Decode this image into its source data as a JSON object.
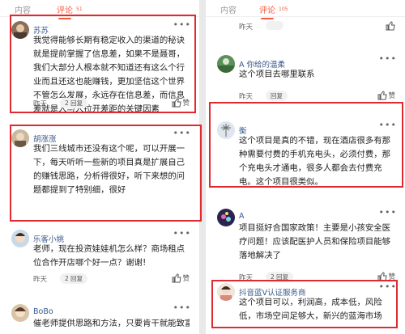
{
  "left": {
    "tabs": [
      {
        "label": "内容"
      },
      {
        "label": "评论",
        "count": "51"
      }
    ],
    "comments": [
      {
        "name": "苏苏",
        "text": "我觉得能够长期有稳定收入的渠道的秘诀就是提前掌握了信息差，如果不是聂哥，我们大部分人根本就不知道还有这么个行业而且还这也能赚钱，更加坚信这个世界不管怎么发展，永远存在信息差，而信息差就是人与人拉开差距的关键因素",
        "time": "昨天",
        "replies": "2 回复",
        "like": "赞"
      },
      {
        "name": "胡涨涨",
        "text": "我们三线城市还没有这个呢，可以开展一下，每天听听一些新的项目真是扩展自己的赚钱思路，分析得很好，听下来想的问题都提到了特别细，很好",
        "time": "",
        "replies": "",
        "like": ""
      },
      {
        "name": "乐客小姚",
        "text": "老师，现在投资娃娃机怎么样？商场租点位合作开店哪个好一点？谢谢!",
        "time": "昨天",
        "replies": "2 回复",
        "like": "赞"
      },
      {
        "name": "BoBo",
        "text": "催老师提供思路和方法，只要肯干就能致富",
        "time": "",
        "replies": "",
        "like": ""
      }
    ]
  },
  "right": {
    "tabs": [
      {
        "label": "内容"
      },
      {
        "label": "评论",
        "count": "105"
      }
    ],
    "comments": [
      {
        "name": "",
        "text": "",
        "time": "昨天",
        "replies": "",
        "like": ""
      },
      {
        "name": "A 你给的温柔",
        "text": "这个项目去哪里联系",
        "time": "昨天",
        "replies": "回复",
        "like": "赞"
      },
      {
        "name": "衡",
        "text": "这个项目是真的不错，现在酒店很多有那种需要付费的手机充电头，必须付费，那个充电头才通电，很多人都会去付费充电。这个项目很类似。",
        "time": "",
        "replies": "",
        "like": ""
      },
      {
        "name": "A",
        "text": "项目挺好合国家政策！主要是小孩安全医疗问题！应该配医护人员和保险项目能够落地解决了",
        "time": "昨天",
        "replies": "2 回复",
        "like": "赞"
      },
      {
        "name": "抖音蓝V认证服务商",
        "text": "这个项目可以，利润高，成本低，风险低，市场空间足够大，新兴的蓝海市场",
        "time": "",
        "replies": "",
        "like": ""
      }
    ]
  },
  "colors": {
    "accent": "#f55a3d",
    "highlight": "#e2292f",
    "username": "#3a5a8c"
  }
}
